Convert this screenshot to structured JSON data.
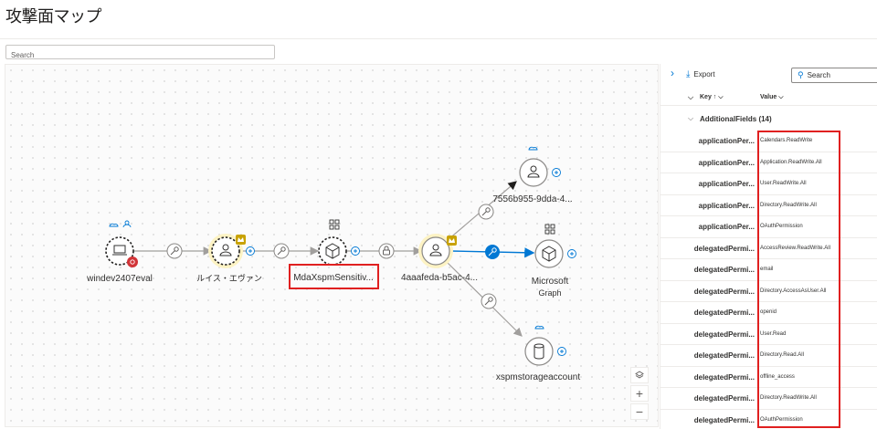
{
  "page": {
    "title": "攻撃面マップ"
  },
  "search": {
    "placeholder": "Search"
  },
  "graph": {
    "nodes": {
      "windev": "windev2407eval",
      "luis": "ルイス・エヴァン",
      "mda": "MdaXspmSensitiv...",
      "aaaf": "4aaafeda-b5ac-4...",
      "n7556": "7556b955-9dda-4...",
      "graph1": "Microsoft",
      "graph2": "Graph",
      "storage": "xspmstorageaccount"
    },
    "icons": {
      "device": "laptop-icon",
      "user": "user-icon",
      "app": "cube-icon",
      "db": "database-icon",
      "key": "key-icon",
      "lock": "lock-icon",
      "crown": "crown-icon"
    },
    "colors": {
      "accent": "#0078d4",
      "highlight": "#e02020",
      "gold": "#c8a200",
      "danger": "#d13438"
    }
  },
  "zoom": {
    "plus": "+",
    "minus": "−"
  },
  "panel": {
    "export_label": "Export",
    "search_placeholder": "Search",
    "key_header": "Key ↑",
    "value_header": "Value",
    "group_label": "AdditionalFields (14)",
    "rows": [
      {
        "key": "applicationPer...",
        "value": "Calendars.ReadWrite"
      },
      {
        "key": "applicationPer...",
        "value": "Application.ReadWrite.All"
      },
      {
        "key": "applicationPer...",
        "value": "User.ReadWrite.All"
      },
      {
        "key": "applicationPer...",
        "value": "Directory.ReadWrite.All"
      },
      {
        "key": "applicationPer...",
        "value": "OAuthPermission"
      },
      {
        "key": "delegatedPermi...",
        "value": "AccessReview.ReadWrite.All"
      },
      {
        "key": "delegatedPermi...",
        "value": "email"
      },
      {
        "key": "delegatedPermi...",
        "value": "Directory.AccessAsUser.All"
      },
      {
        "key": "delegatedPermi...",
        "value": "openid"
      },
      {
        "key": "delegatedPermi...",
        "value": "User.Read"
      },
      {
        "key": "delegatedPermi...",
        "value": "Directory.Read.All"
      },
      {
        "key": "delegatedPermi...",
        "value": "offline_access"
      },
      {
        "key": "delegatedPermi...",
        "value": "Directory.ReadWrite.All"
      },
      {
        "key": "delegatedPermi...",
        "value": "OAuthPermission"
      }
    ]
  }
}
